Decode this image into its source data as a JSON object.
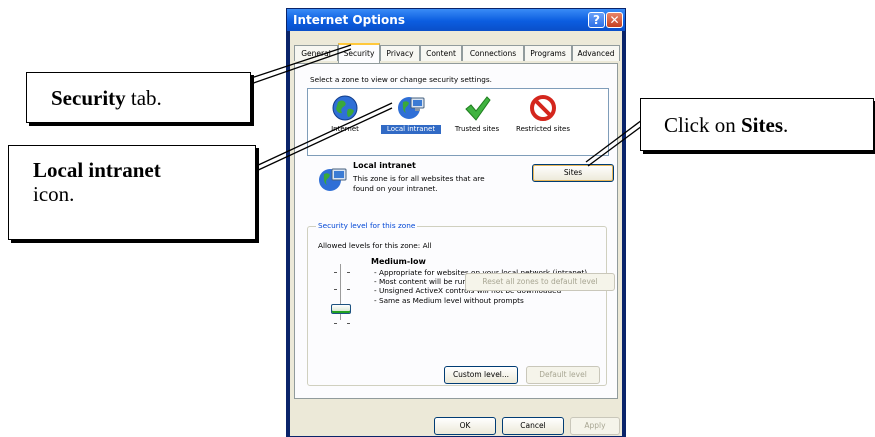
{
  "dialog": {
    "title": "Internet Options",
    "help_glyph": "?",
    "close_glyph": "✕",
    "tabs": [
      {
        "label": "General",
        "active": false
      },
      {
        "label": "Security",
        "active": true
      },
      {
        "label": "Privacy",
        "active": false
      },
      {
        "label": "Content",
        "active": false
      },
      {
        "label": "Connections",
        "active": false
      },
      {
        "label": "Programs",
        "active": false
      },
      {
        "label": "Advanced",
        "active": false
      }
    ],
    "security": {
      "zone_prompt": "Select a zone to view or change security settings.",
      "zones": [
        {
          "label": "Internet",
          "icon": "globe-icon",
          "selected": false
        },
        {
          "label": "Local intranet",
          "icon": "local-intranet-icon",
          "selected": true
        },
        {
          "label": "Trusted sites",
          "icon": "checkmark-icon",
          "selected": false
        },
        {
          "label": "Restricted sites",
          "icon": "restricted-icon",
          "selected": false
        }
      ],
      "zone_info": {
        "title": "Local intranet",
        "description": "This zone is for all websites that are found on your intranet."
      },
      "sites_button": "Sites",
      "level_group": {
        "legend": "Security level for this zone",
        "allowed": "Allowed levels for this zone: All",
        "level_name": "Medium-low",
        "level_lines": [
          "- Appropriate for websites on your local network (intranet)",
          "- Most content will be run without prompting you",
          "- Unsigned ActiveX controls will not be downloaded",
          "- Same as Medium level without prompts"
        ],
        "slider_level_index": 1,
        "slider_levels": 4
      },
      "custom_level_button": "Custom level...",
      "default_level_button": "Default level",
      "reset_button": "Reset all zones to default level"
    },
    "footer": {
      "ok": "OK",
      "cancel": "Cancel",
      "apply": "Apply"
    }
  },
  "callouts": {
    "security": {
      "bold": "Security",
      "rest": " tab."
    },
    "local": {
      "bold": "Local intranet",
      "rest": "icon."
    },
    "sites": {
      "pre": "Click on ",
      "bold": "Sites",
      "post": "."
    }
  },
  "colors": {
    "title_bar": "#0b5de0",
    "selection": "#316ac5",
    "legend_text": "#0046d5"
  }
}
